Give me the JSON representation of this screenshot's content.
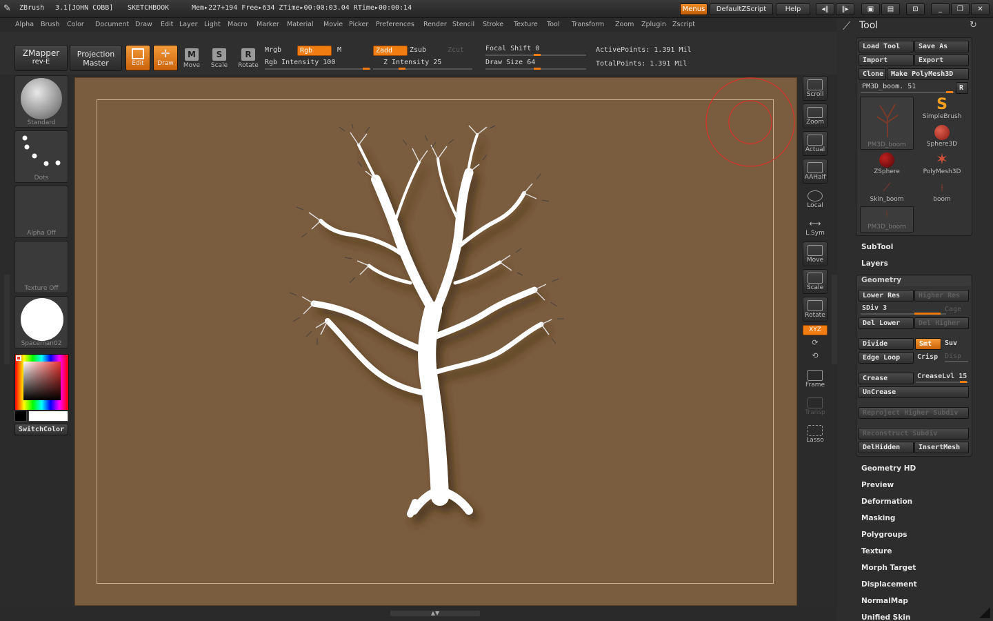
{
  "titlebar": {
    "app": "ZBrush",
    "version": "3.1[JOHN COBB]",
    "doc": "SKETCHBOOK",
    "stats": "Mem▸227+194 Free▸634 ZTime▸00:00:03.04 RTime▸00:00:14",
    "menus_btn": "Menus",
    "script_btn": "DefaultZScript",
    "help_btn": "Help"
  },
  "menubar": [
    "Alpha",
    "Brush",
    "Color",
    "Document",
    "Draw",
    "Edit",
    "Layer",
    "Light",
    "Macro",
    "Marker",
    "Material",
    "Movie",
    "Picker",
    "Preferences",
    "Render",
    "Stencil",
    "Stroke",
    "Texture",
    "Tool",
    "Transform",
    "Zoom",
    "Zplugin",
    "Zscript"
  ],
  "shelf": {
    "zmapper_l1": "ZMapper",
    "zmapper_l2": "rev-E",
    "projection_l1": "Projection",
    "projection_l2": "Master",
    "edit": "Edit",
    "draw": "Draw",
    "move": "Move",
    "scale": "Scale",
    "rotate": "Rotate",
    "mrgb": "Mrgb",
    "rgb": "Rgb",
    "m": "M",
    "rgb_intensity": "Rgb Intensity 100",
    "zadd": "Zadd",
    "zsub": "Zsub",
    "zcut": "Zcut",
    "z_intensity": "Z Intensity 25",
    "focal_shift": "Focal Shift 0",
    "draw_size": "Draw Size 64",
    "active_points": "ActivePoints: 1.391  Mil",
    "total_points": "TotalPoints: 1.391  Mil"
  },
  "left": {
    "brush": "Standard",
    "stroke": "Dots",
    "alpha": "Alpha  Off",
    "texture": "Texture  Off",
    "material": "Spaceman02",
    "switch_color": "SwitchColor"
  },
  "right_tools": [
    "Scroll",
    "Zoom",
    "Actual",
    "AAHalf",
    "Local",
    "L.Sym",
    "Move",
    "Scale",
    "Rotate",
    "XYZ",
    "Frame",
    "Transp",
    "Lasso"
  ],
  "palette": {
    "title": "Tool",
    "load_tool": "Load Tool",
    "save_as": "Save As",
    "import": "Import",
    "export": "Export",
    "clone": "Clone",
    "make_polymesh": "Make PolyMesh3D",
    "current_tool": "PM3D_boom. 51",
    "r": "R",
    "thumbs": [
      "PM3D_boom",
      "SimpleBrush",
      "Sphere3D",
      "ZSphere",
      "PolyMesh3D",
      "Skin_boom",
      "boom",
      "PM3D_boom"
    ],
    "subtool": "SubTool",
    "layers": "Layers",
    "geometry": "Geometry",
    "lower_res": "Lower Res",
    "higher_res": "Higher Res",
    "sdiv": "SDiv 3",
    "cage": "Cage",
    "del_lower": "Del Lower",
    "del_higher": "Del Higher",
    "divide": "Divide",
    "smt": "Smt",
    "suv": "Suv",
    "edge_loop": "Edge Loop",
    "crisp": "Crisp",
    "disp": "Disp",
    "crease": "Crease",
    "crease_lvl": "CreaseLvl 15",
    "uncrease": "UnCrease",
    "reproject": "Reproject Higher Subdiv",
    "reconstruct": "Reconstruct Subdiv",
    "delhidden": "DelHidden",
    "insertmesh": "InsertMesh",
    "sections": [
      "Geometry HD",
      "Preview",
      "Deformation",
      "Masking",
      "Polygroups",
      "Texture",
      "Morph Target",
      "Displacement",
      "NormalMap",
      "Unified Skin"
    ]
  }
}
